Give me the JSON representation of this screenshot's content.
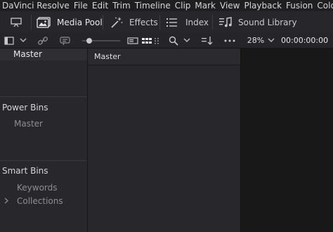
{
  "menu": [
    "DaVinci Resolve",
    "File",
    "Edit",
    "Trim",
    "Timeline",
    "Clip",
    "Mark",
    "View",
    "Playback",
    "Fusion",
    "Color"
  ],
  "toolbar": {
    "media_pool": "Media Pool",
    "effects": "Effects",
    "index": "Index",
    "sound_library": "Sound Library"
  },
  "subbar": {
    "zoom": "28%",
    "timecode": "00:00:00:00"
  },
  "bins": {
    "master": "Master",
    "power_bins_title": "Power Bins",
    "power_bins_master": "Master",
    "smart_bins_title": "Smart Bins",
    "smart_bins_items": [
      "Keywords",
      "Collections"
    ]
  },
  "media_pool_panel": {
    "header": "Master"
  },
  "colors": {
    "accent_active": "#e8e8ea",
    "panel": "#28282c",
    "viewer": "#181818"
  }
}
